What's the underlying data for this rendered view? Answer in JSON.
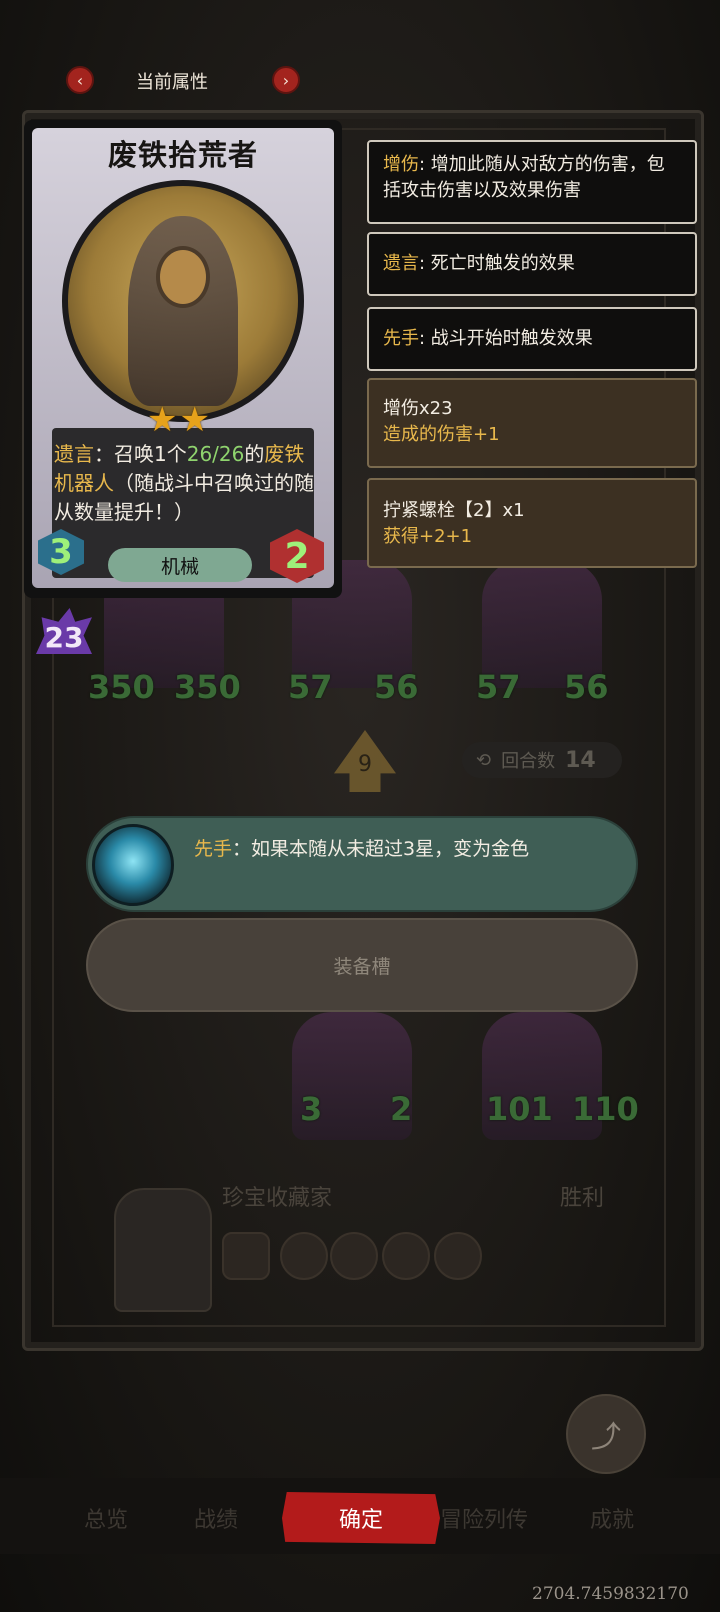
{
  "top_nav": {
    "title": "当前属性",
    "prev_icon": "chevron-left-icon",
    "next_icon": "chevron-right-icon"
  },
  "card": {
    "name": "废铁拾荒者",
    "star_count": 2,
    "stars": "★★",
    "ability_keyword": "遗言",
    "ability_colon": "：召唤",
    "ability_count": "1",
    "ability_unit": "个",
    "ability_stats": "26/26",
    "ability_of": "的",
    "ability_target": "废铁机器人",
    "ability_tail": "（随战斗中召唤过的随从数量提升！）",
    "cost": "3",
    "attack": "2",
    "tribe": "机械"
  },
  "level": "23",
  "tooltips": [
    {
      "keyword": "增伤",
      "text": ": 增加此随从对敌方的伤害，包括攻击伤害以及效果伤害"
    },
    {
      "keyword": "遗言",
      "text": ": 死亡时触发的效果"
    },
    {
      "keyword": "先手",
      "text": ": 战斗开始时触发效果"
    },
    {
      "title": "增伤x23",
      "sub": "造成的伤害+1"
    },
    {
      "title": "拧紧螺栓【2】x1",
      "sub": "获得+2+1"
    }
  ],
  "board": {
    "top_row": [
      {
        "attack": "350",
        "health": "350"
      },
      {
        "attack": "57",
        "health": "56"
      },
      {
        "attack": "57",
        "health": "56"
      }
    ],
    "bottom_row": [
      {
        "attack": "3",
        "health": "2"
      },
      {
        "attack": "101",
        "health": "110"
      }
    ],
    "turn_number": "9",
    "round_label": "回合数",
    "round_value": "14"
  },
  "banner": {
    "keyword": "先手",
    "text": "：如果本随从未超过3星，变为金色"
  },
  "equip_slot_label": "装备槽",
  "opponent": {
    "name": "珍宝收藏家",
    "result": "胜利"
  },
  "share_label": "分享",
  "bottom_tabs": [
    "总览",
    "战绩",
    "冒险列传",
    "成就"
  ],
  "confirm_label": "确定",
  "build_code": "2704.7459832170",
  "colors": {
    "accent_red": "#b31b1b",
    "keyword_gold": "#e8b84c",
    "stat_green": "#8fd36e",
    "banner_green": "#3f5e55"
  }
}
